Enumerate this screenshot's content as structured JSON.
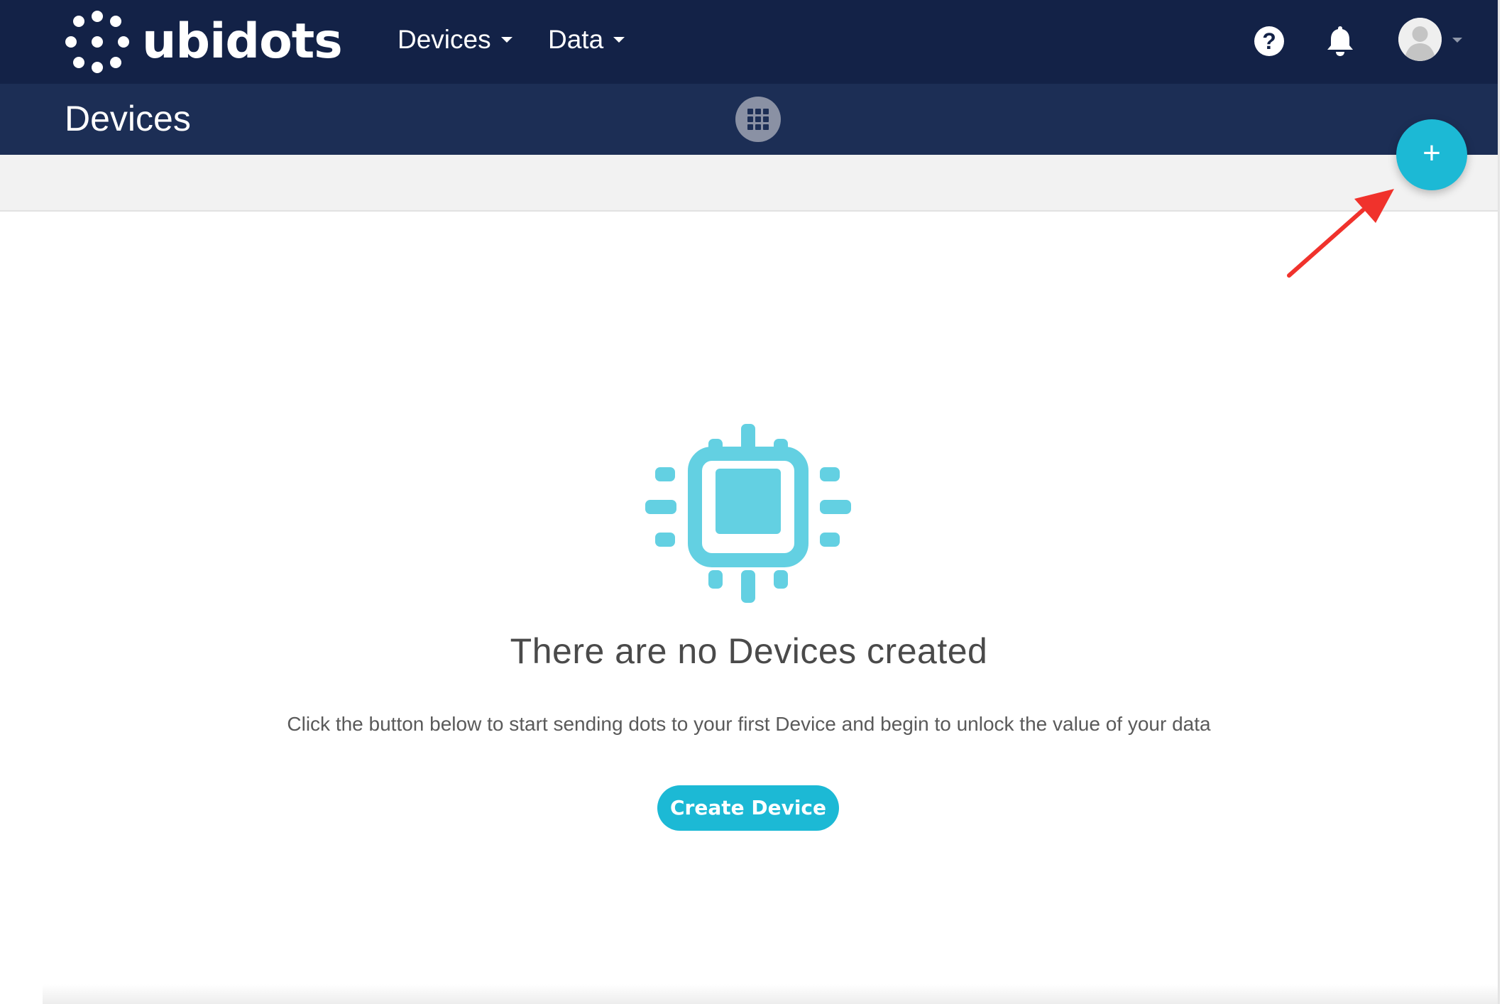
{
  "topbar": {
    "logo_text": "ubidots",
    "nav": [
      {
        "label": "Devices",
        "icon": "caret-down-icon"
      },
      {
        "label": "Data",
        "icon": "caret-down-icon"
      }
    ],
    "help_icon": "question-circle-icon",
    "help_glyph": "?",
    "notifications_icon": "bell-icon",
    "avatar_icon": "user-avatar-icon"
  },
  "header": {
    "title": "Devices",
    "view_toggle_icon": "grid-icon",
    "add_glyph": "+"
  },
  "empty_state": {
    "icon": "chip-icon",
    "title": "There are no Devices created",
    "description": "Click the button below to start sending dots to your first Device and begin to unlock the value of your data",
    "button_label": "Create Device"
  },
  "colors": {
    "topbar_bg": "#132247",
    "headerbar_bg": "#1c2e55",
    "accent": "#1cb9d5",
    "chip_icon": "#63d0e2",
    "annotation_arrow": "#f0322c"
  }
}
